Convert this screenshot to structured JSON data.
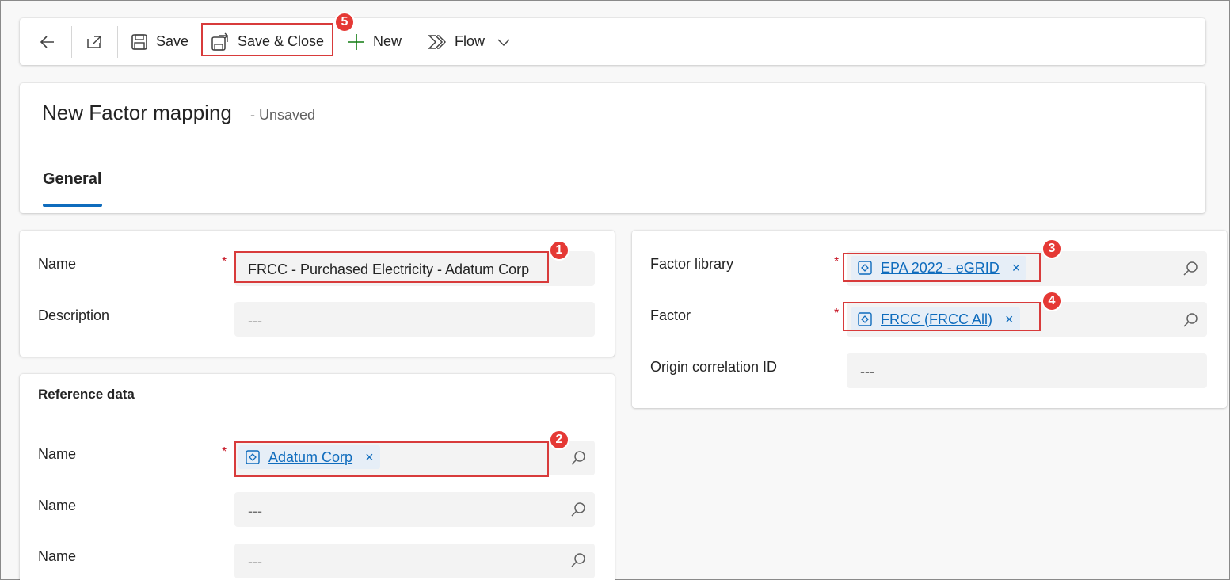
{
  "toolbar": {
    "save_label": "Save",
    "save_close_label": "Save & Close",
    "new_label": "New",
    "flow_label": "Flow"
  },
  "header": {
    "title": "New Factor mapping",
    "status": "- Unsaved",
    "tabs": [
      {
        "label": "General"
      }
    ]
  },
  "left_form": {
    "name_label": "Name",
    "name_value": "FRCC - Purchased Electricity - Adatum Corp",
    "description_label": "Description",
    "description_placeholder": "---"
  },
  "reference_data": {
    "title": "Reference data",
    "rows": [
      {
        "label": "Name",
        "chip": "Adatum Corp"
      },
      {
        "label": "Name",
        "placeholder": "---"
      },
      {
        "label": "Name",
        "placeholder": "---"
      }
    ]
  },
  "right_form": {
    "factor_library_label": "Factor library",
    "factor_library_value": "EPA 2022 - eGRID",
    "factor_label": "Factor",
    "factor_value": "FRCC (FRCC All)",
    "origin_label": "Origin correlation ID",
    "origin_placeholder": "---"
  },
  "required_marker": "*",
  "chip_remove": "×",
  "callouts": [
    "1",
    "2",
    "3",
    "4",
    "5"
  ],
  "colors": {
    "accent": "#0f6cbd",
    "callout_red": "#d83b3b",
    "badge_red": "#e53935",
    "required": "#c50f1f",
    "new_plus": "#107c10"
  },
  "icons": [
    "back-arrow-icon",
    "open-new-window-icon",
    "save-icon",
    "save-close-icon",
    "plus-icon",
    "flow-icon",
    "chevron-down-icon",
    "lookup-search-icon",
    "entity-icon"
  ]
}
